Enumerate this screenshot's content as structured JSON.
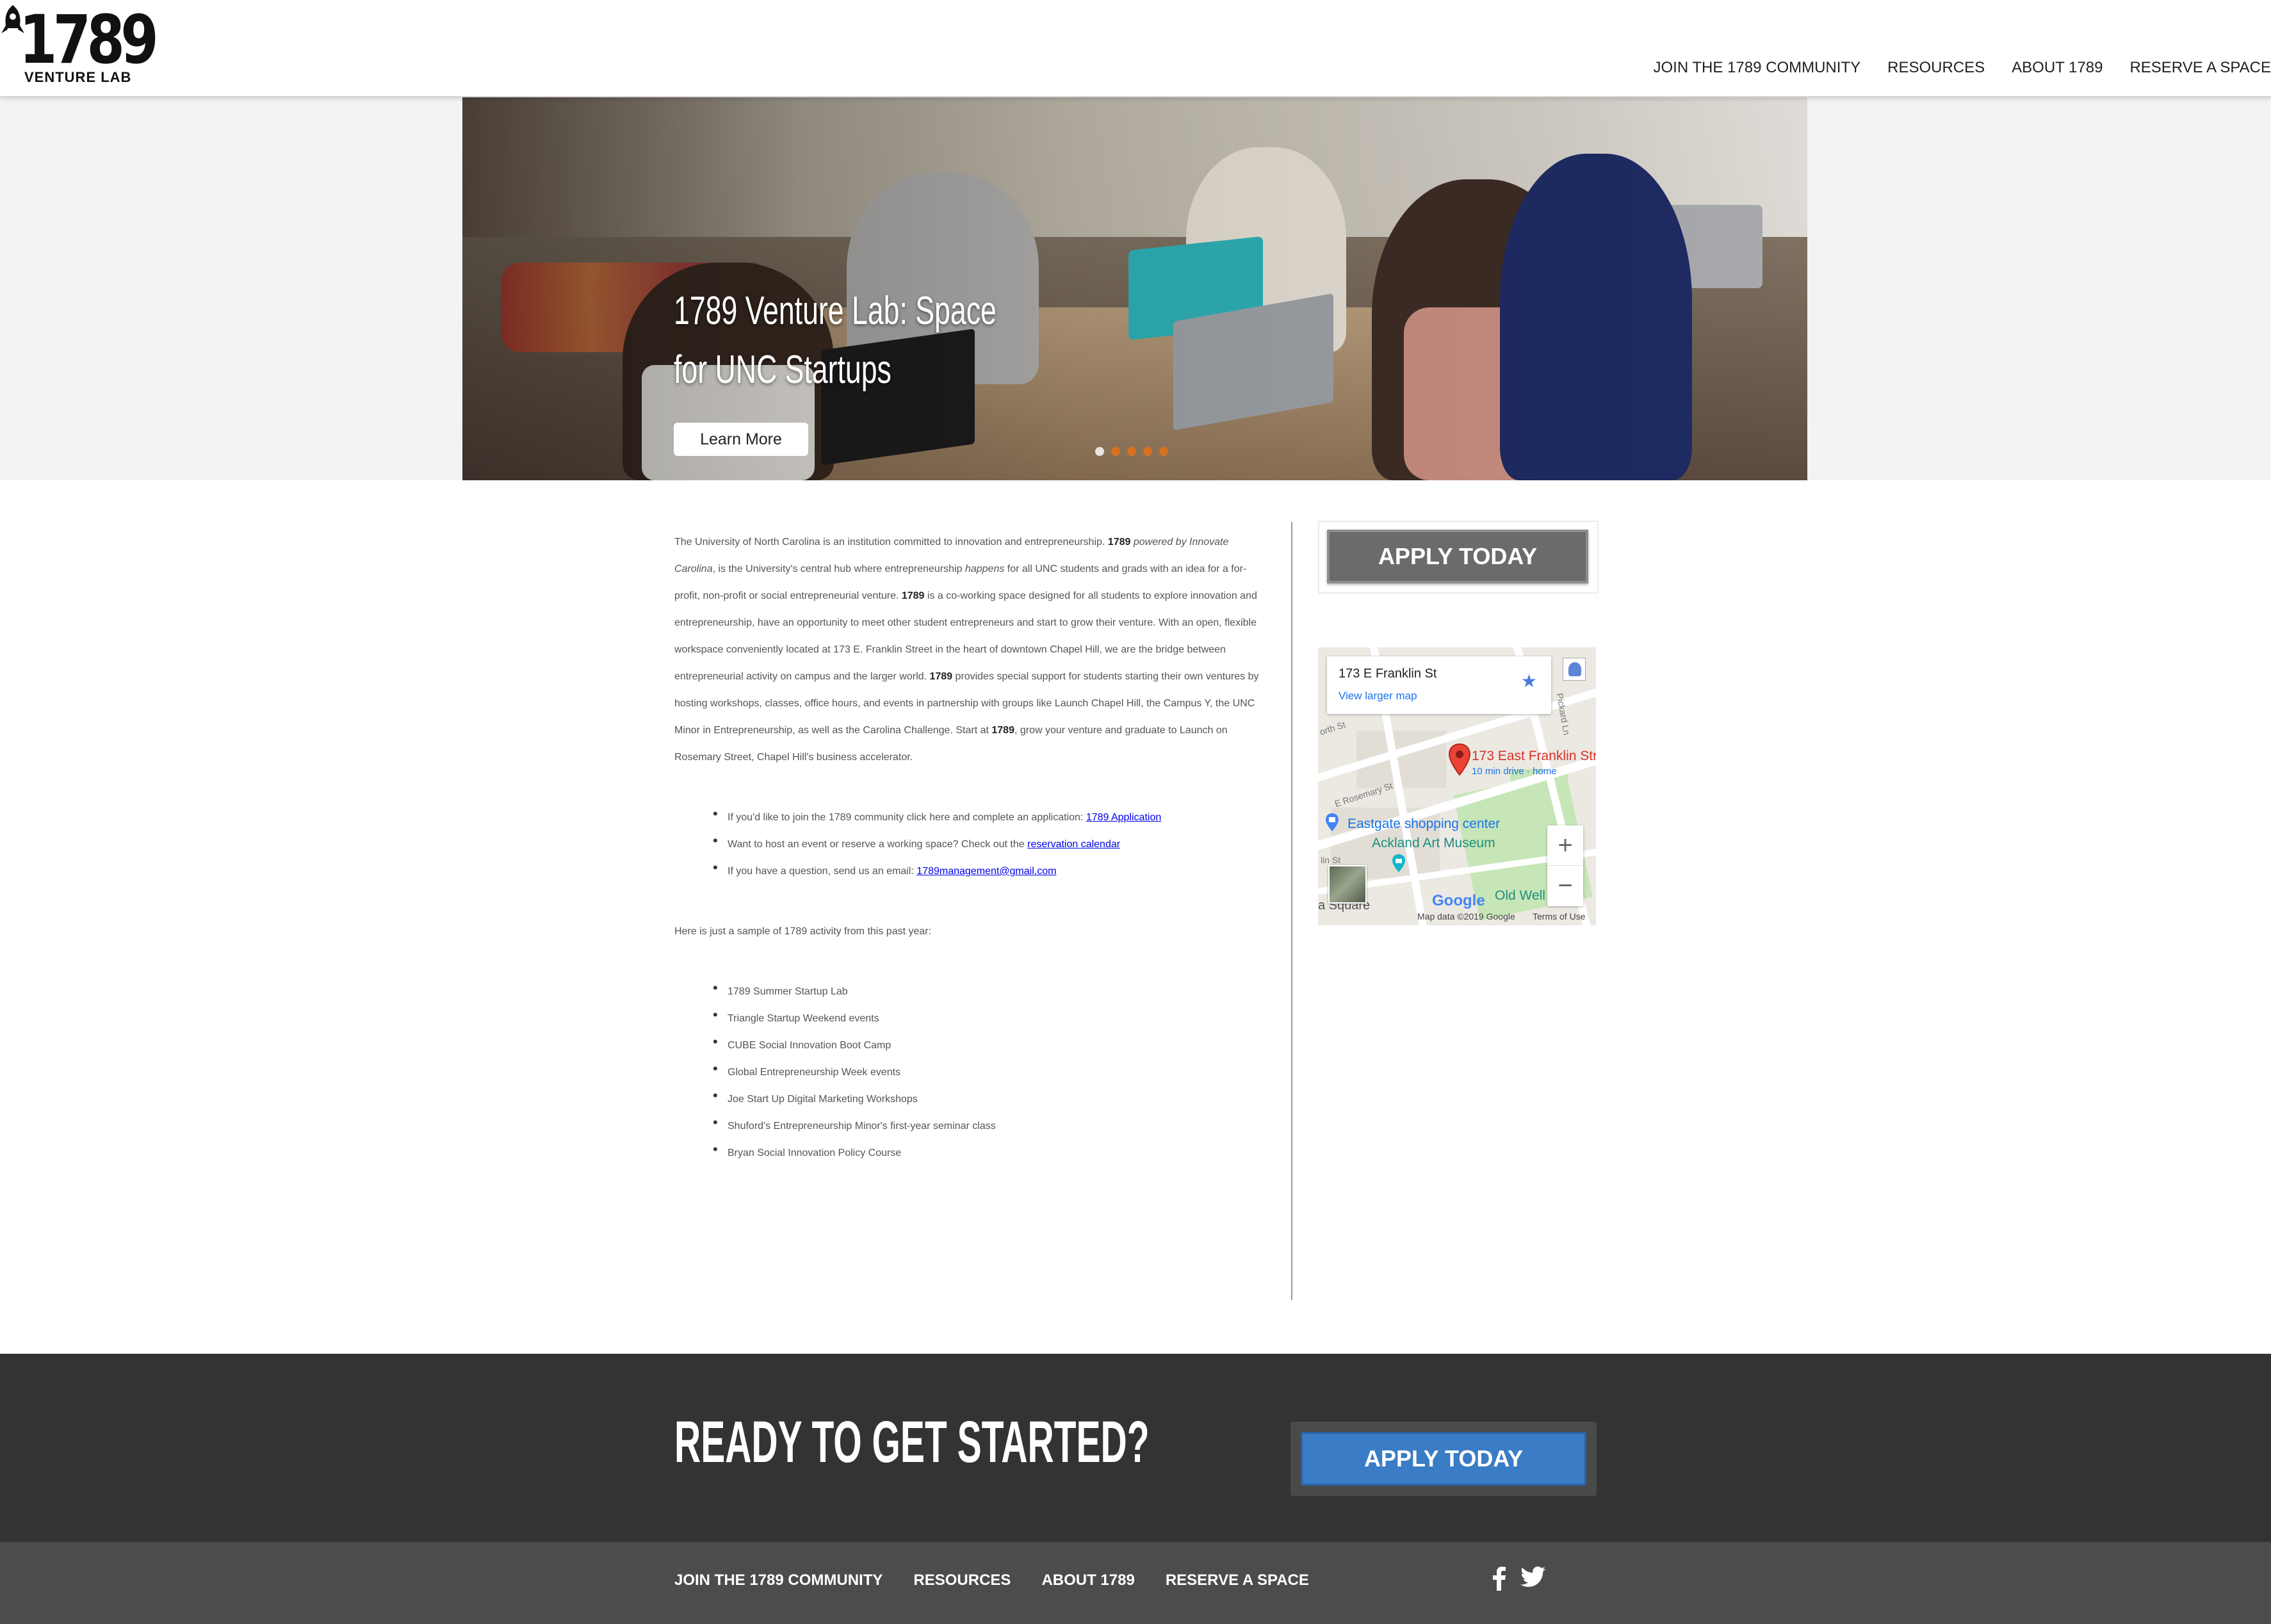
{
  "header": {
    "logo_number": "1789",
    "logo_subtitle": "VENTURE LAB",
    "nav": [
      "JOIN THE 1789 COMMUNITY",
      "RESOURCES",
      "ABOUT 1789",
      "RESERVE A SPACE"
    ]
  },
  "hero": {
    "title": "1789 Venture Lab: Space for UNC Startups",
    "button": "Learn More",
    "slide_count": 5,
    "active_slide": 1
  },
  "main": {
    "intro": {
      "t1": "The University of North Carolina is an institution committed to innovation and entrepreneurship. ",
      "b1": "1789",
      "t2": " ",
      "i1": "powered by Innovate Carolina",
      "t3": ", is the University's central hub where entrepreneurship ",
      "i2": "happens",
      "t4": " for all UNC students and grads with an idea for a for-profit, non-profit or social entrepreneurial venture.  ",
      "b2": "1789",
      "t5": " is a co-working space designed for all students to explore innovation and entrepreneurship, have an opportunity to meet other student entrepreneurs and start to grow their venture.  With an open, flexible workspace conveniently located at 173 E. Franklin Street in the heart of downtown Chapel Hill, we are the bridge between entrepreneurial activity on campus and the larger world.   ",
      "b3": "1789",
      "t6": " provides special support for students starting their own ventures by hosting workshops, classes, office hours, and events in partnership with groups like Launch Chapel Hill, the Campus Y, the UNC Minor in Entrepreneurship, as well as the Carolina Challenge.  Start at ",
      "b4": "1789",
      "t7": ", grow your venture and graduate to Launch on Rosemary Street, Chapel Hill's business accelerator."
    },
    "links": [
      {
        "text": "If you'd like to join the 1789 community click here and complete an application: ",
        "link": "1789 Application"
      },
      {
        "text": "Want to host an event or reserve a working space?  Check out the ",
        "link": "reservation calendar"
      },
      {
        "text": "If you have a question, send us an email:  ",
        "link": "1789management@gmail.com "
      }
    ],
    "sample_intro": "Here is just a sample of 1789 activity from this past year:",
    "activities": [
      "1789 Summer Startup Lab",
      "Triangle Startup Weekend events",
      "CUBE Social Innovation Boot Camp",
      "Global Entrepreneurship Week events",
      "Joe Start Up Digital Marketing Workshops",
      "Shuford's Entrepreneurship Minor's first-year seminar class",
      "Bryan Social Innovation Policy Course"
    ]
  },
  "sidebar": {
    "apply_button": "APPLY TODAY",
    "map": {
      "card_title": "173 E Franklin St",
      "card_link": "View larger map",
      "pin_label": "173 East Franklin Stre",
      "pin_sub": "10 min drive · home",
      "poi_1": "Eastgate shopping center",
      "poi_2": "Ackland Art Museum",
      "poi_3": "Old Well",
      "place_1": "a Square",
      "street_1": "E Rosemary St",
      "street_2": "orth St",
      "street_3": "Pickard Ln",
      "street_4": "lin St",
      "zoom_in": "+",
      "zoom_out": "−",
      "logo": "Google",
      "attribution": "Map data ©2019 Google",
      "terms": "Terms of Use"
    }
  },
  "cta": {
    "title": "READY TO GET STARTED?",
    "button": "APPLY TODAY"
  },
  "footer": {
    "nav": [
      "JOIN THE 1789 COMMUNITY",
      "RESOURCES",
      "ABOUT 1789",
      "RESERVE A SPACE"
    ],
    "social": [
      "facebook-icon",
      "twitter-icon"
    ]
  },
  "colors": {
    "cta_background": "#333333",
    "footer_background": "#4c4c4c",
    "apply_blue": "#3a7cc5",
    "apply_grey": "#6b6b6b",
    "slider_dot": "#e0701c"
  }
}
